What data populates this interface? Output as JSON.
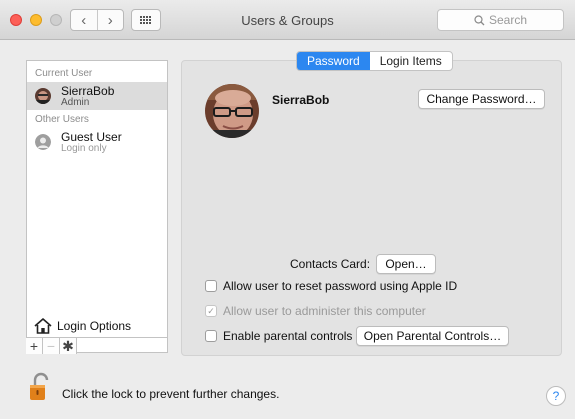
{
  "window": {
    "title": "Users & Groups",
    "search_placeholder": "Search",
    "back_glyph": "‹",
    "forward_glyph": "›"
  },
  "sidebar": {
    "current_user_header": "Current User",
    "other_users_header": "Other Users",
    "users": [
      {
        "name": "SierraBob",
        "role": "Admin"
      },
      {
        "name": "Guest User",
        "role": "Login only"
      }
    ],
    "login_options_label": "Login Options",
    "add_glyph": "+",
    "remove_glyph": "−",
    "actions_glyph": "✱"
  },
  "tabs": [
    {
      "label": "Password",
      "active": true
    },
    {
      "label": "Login Items",
      "active": false
    }
  ],
  "main": {
    "username": "SierraBob",
    "change_password_label": "Change Password…",
    "contacts_card_label": "Contacts Card:",
    "open_label": "Open…",
    "options": [
      {
        "label": "Allow user to reset password using Apple ID",
        "checked": false,
        "disabled": false
      },
      {
        "label": "Allow user to administer this computer",
        "checked": true,
        "disabled": true
      },
      {
        "label": "Enable parental controls",
        "checked": false,
        "disabled": false
      }
    ],
    "open_parental_controls_label": "Open Parental Controls…"
  },
  "footer": {
    "lock_text": "Click the lock to prevent further changes.",
    "help_glyph": "?"
  },
  "colors": {
    "accent": "#2c87f0",
    "close": "#fc5f57",
    "minimize": "#fdbc2e",
    "lock": "#e0801a"
  },
  "icons": [
    "back-icon",
    "forward-icon",
    "show-all-grid-icon",
    "search-icon",
    "user-avatar",
    "guest-user-icon",
    "house-icon",
    "gear-icon",
    "lock-icon",
    "help-icon"
  ]
}
